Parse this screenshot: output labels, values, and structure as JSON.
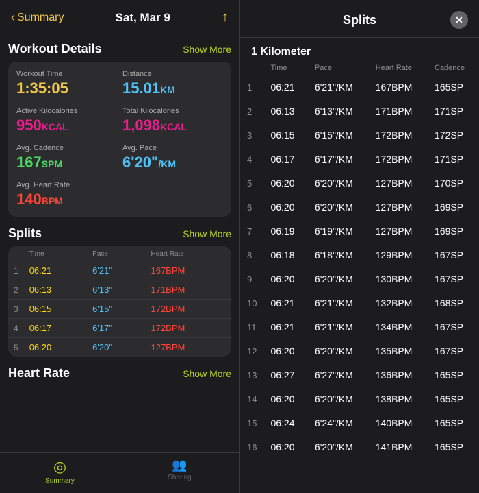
{
  "left": {
    "header": {
      "back_label": "Summary",
      "title": "Sat, Mar 9",
      "share_icon": "↑"
    },
    "workout_details": {
      "section_title": "Workout Details",
      "show_more": "Show More",
      "metrics": [
        {
          "label": "Workout Time",
          "value": "1:35:05",
          "unit": "",
          "color": "yellow"
        },
        {
          "label": "Distance",
          "value": "15.01",
          "unit": "KM",
          "color": "blue"
        },
        {
          "label": "Active Kilocalories",
          "value": "950",
          "unit": "KCAL",
          "color": "pink"
        },
        {
          "label": "Total Kilocalories",
          "value": "1,098",
          "unit": "KCAL",
          "color": "pink"
        },
        {
          "label": "Avg. Cadence",
          "value": "167",
          "unit": "SPM",
          "color": "green"
        },
        {
          "label": "Avg. Pace",
          "value": "6'20\"",
          "unit": "/KM",
          "color": "blue"
        },
        {
          "label": "Avg. Heart Rate",
          "value": "140",
          "unit": "BPM",
          "color": "red"
        }
      ]
    },
    "splits": {
      "section_title": "Splits",
      "show_more": "Show More",
      "columns": [
        "",
        "Time",
        "Pace",
        "Heart Rate"
      ],
      "rows": [
        {
          "num": "1",
          "time": "06:21",
          "pace": "6'21\"",
          "hr": "167BPM"
        },
        {
          "num": "2",
          "time": "06:13",
          "pace": "6'13\"",
          "hr": "171BPM"
        },
        {
          "num": "3",
          "time": "06:15",
          "pace": "6'15\"",
          "hr": "172BPM"
        },
        {
          "num": "4",
          "time": "06:17",
          "pace": "6'17\"",
          "hr": "172BPM"
        },
        {
          "num": "5",
          "time": "06:20",
          "pace": "6'20\"",
          "hr": "127BPM"
        }
      ]
    },
    "heart_rate": {
      "section_title": "Heart Rate",
      "show_more": "Show More"
    },
    "tabs": [
      {
        "id": "summary",
        "label": "Summary",
        "icon": "◎",
        "active": true
      },
      {
        "id": "sharing",
        "label": "Sharing",
        "icon": "👥",
        "active": false
      }
    ]
  },
  "right": {
    "header": {
      "title": "Splits",
      "close_label": "✕"
    },
    "km_label": "1 Kilometer",
    "columns": [
      "",
      "Time",
      "Pace",
      "Heart Rate",
      "Cadence"
    ],
    "rows": [
      {
        "num": "1",
        "time": "06:21",
        "pace": "6'21\"/KM",
        "hr": "167BPM",
        "cad": "165SP"
      },
      {
        "num": "2",
        "time": "06:13",
        "pace": "6'13\"/KM",
        "hr": "171BPM",
        "cad": "171SP"
      },
      {
        "num": "3",
        "time": "06:15",
        "pace": "6'15\"/KM",
        "hr": "172BPM",
        "cad": "172SP"
      },
      {
        "num": "4",
        "time": "06:17",
        "pace": "6'17\"/KM",
        "hr": "172BPM",
        "cad": "171SP"
      },
      {
        "num": "5",
        "time": "06:20",
        "pace": "6'20\"/KM",
        "hr": "127BPM",
        "cad": "170SP"
      },
      {
        "num": "6",
        "time": "06:20",
        "pace": "6'20\"/KM",
        "hr": "127BPM",
        "cad": "169SP"
      },
      {
        "num": "7",
        "time": "06:19",
        "pace": "6'19\"/KM",
        "hr": "127BPM",
        "cad": "169SP"
      },
      {
        "num": "8",
        "time": "06:18",
        "pace": "6'18\"/KM",
        "hr": "129BPM",
        "cad": "167SP"
      },
      {
        "num": "9",
        "time": "06:20",
        "pace": "6'20\"/KM",
        "hr": "130BPM",
        "cad": "167SP"
      },
      {
        "num": "10",
        "time": "06:21",
        "pace": "6'21\"/KM",
        "hr": "132BPM",
        "cad": "168SP"
      },
      {
        "num": "11",
        "time": "06:21",
        "pace": "6'21\"/KM",
        "hr": "134BPM",
        "cad": "167SP"
      },
      {
        "num": "12",
        "time": "06:20",
        "pace": "6'20\"/KM",
        "hr": "135BPM",
        "cad": "167SP"
      },
      {
        "num": "13",
        "time": "06:27",
        "pace": "6'27\"/KM",
        "hr": "136BPM",
        "cad": "165SP"
      },
      {
        "num": "14",
        "time": "06:20",
        "pace": "6'20\"/KM",
        "hr": "138BPM",
        "cad": "165SP"
      },
      {
        "num": "15",
        "time": "06:24",
        "pace": "6'24\"/KM",
        "hr": "140BPM",
        "cad": "165SP"
      },
      {
        "num": "16",
        "time": "06:20",
        "pace": "6'20\"/KM",
        "hr": "141BPM",
        "cad": "165SP"
      }
    ]
  }
}
